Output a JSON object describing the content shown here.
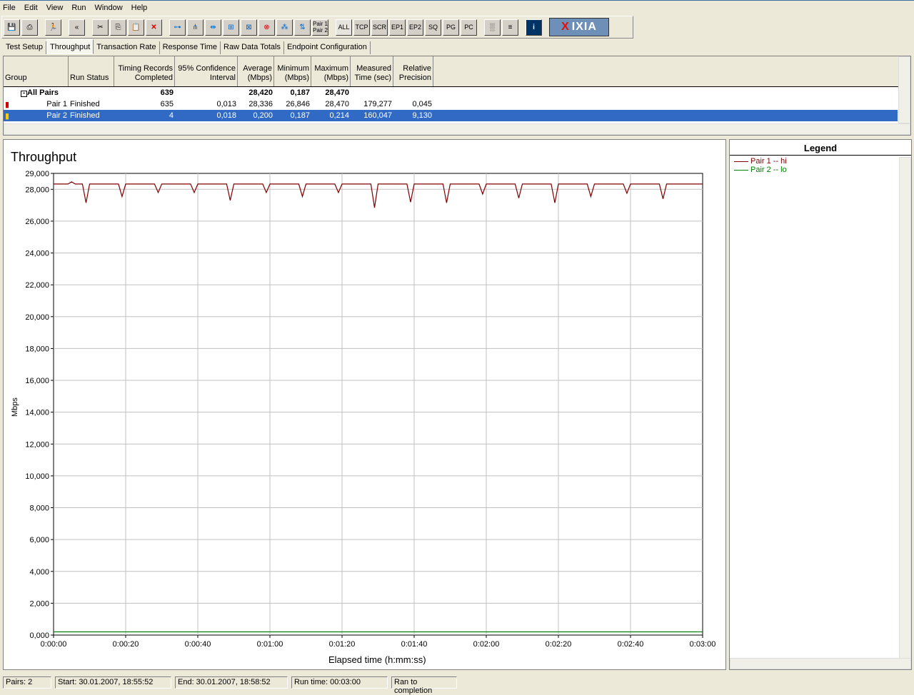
{
  "menu": [
    "File",
    "Edit",
    "View",
    "Run",
    "Window",
    "Help"
  ],
  "toolbar": {
    "text_buttons": [
      "ALL",
      "TCP",
      "SCR",
      "EP1",
      "EP2",
      "SQ",
      "PG",
      "PC"
    ],
    "pair_button": [
      "Pair 1",
      "Pair 2"
    ],
    "logo": "IXIA"
  },
  "tabs": [
    "Test Setup",
    "Throughput",
    "Transaction Rate",
    "Response Time",
    "Raw Data Totals",
    "Endpoint Configuration"
  ],
  "active_tab": "Throughput",
  "table": {
    "headers": [
      "Group",
      "Run Status",
      "Timing Records Completed",
      "95% Confidence Interval",
      "Average (Mbps)",
      "Minimum (Mbps)",
      "Maximum (Mbps)",
      "Measured Time (sec)",
      "Relative Precision"
    ],
    "summary": {
      "group": "All Pairs",
      "records": "639",
      "average": "28,420",
      "minimum": "0,187",
      "maximum": "28,470"
    },
    "rows": [
      {
        "group": "Pair 1",
        "status": "Finished",
        "records": "635",
        "ci": "0,013",
        "average": "28,336",
        "minimum": "26,846",
        "maximum": "28,470",
        "time": "179,277",
        "precision": "0,045",
        "selected": false
      },
      {
        "group": "Pair 2",
        "status": "Finished",
        "records": "4",
        "ci": "0,018",
        "average": "0,200",
        "minimum": "0,187",
        "maximum": "0,214",
        "time": "160,047",
        "precision": "9,130",
        "selected": true
      }
    ]
  },
  "legend": {
    "title": "Legend",
    "items": [
      {
        "label": "Pair 1 -- hi",
        "color": "#800000"
      },
      {
        "label": "Pair 2 -- lo",
        "color": "#008000"
      }
    ]
  },
  "chart_data": {
    "type": "line",
    "title": "Throughput",
    "xlabel": "Elapsed time (h:mm:ss)",
    "ylabel": "Mbps",
    "xlim": [
      "0:00:00",
      "0:03:00"
    ],
    "ylim": [
      0,
      29000
    ],
    "grid": true,
    "xticks": [
      "0:00:00",
      "0:00:20",
      "0:00:40",
      "0:01:00",
      "0:01:20",
      "0:01:40",
      "0:02:00",
      "0:02:20",
      "0:02:40",
      "0:03:00"
    ],
    "yticks": [
      "0,000",
      "2,000",
      "4,000",
      "6,000",
      "8,000",
      "10,000",
      "12,000",
      "14,000",
      "16,000",
      "18,000",
      "20,000",
      "22,000",
      "24,000",
      "26,000",
      "28,000",
      "29,000"
    ],
    "series": [
      {
        "name": "Pair 1 -- hi",
        "color": "#800000",
        "points": [
          [
            "0:00:00",
            28330
          ],
          [
            "0:00:04",
            28330
          ],
          [
            "0:00:05",
            28470
          ],
          [
            "0:00:06",
            28330
          ],
          [
            "0:00:08",
            28330
          ],
          [
            "0:00:09",
            27150
          ],
          [
            "0:00:10",
            28330
          ],
          [
            "0:00:18",
            28330
          ],
          [
            "0:00:19",
            27550
          ],
          [
            "0:00:20",
            28330
          ],
          [
            "0:00:28",
            28330
          ],
          [
            "0:00:29",
            27800
          ],
          [
            "0:00:30",
            28330
          ],
          [
            "0:00:38",
            28330
          ],
          [
            "0:00:39",
            27800
          ],
          [
            "0:00:40",
            28330
          ],
          [
            "0:00:48",
            28330
          ],
          [
            "0:00:49",
            27300
          ],
          [
            "0:00:50",
            28330
          ],
          [
            "0:00:58",
            28330
          ],
          [
            "0:00:59",
            27800
          ],
          [
            "0:01:00",
            28330
          ],
          [
            "0:01:08",
            28330
          ],
          [
            "0:01:09",
            27550
          ],
          [
            "0:01:10",
            28330
          ],
          [
            "0:01:18",
            28330
          ],
          [
            "0:01:19",
            27800
          ],
          [
            "0:01:20",
            28330
          ],
          [
            "0:01:28",
            28330
          ],
          [
            "0:01:29",
            26850
          ],
          [
            "0:01:30",
            28330
          ],
          [
            "0:01:38",
            28330
          ],
          [
            "0:01:39",
            27200
          ],
          [
            "0:01:40",
            28330
          ],
          [
            "0:01:48",
            28330
          ],
          [
            "0:01:49",
            27150
          ],
          [
            "0:01:50",
            28330
          ],
          [
            "0:01:58",
            28330
          ],
          [
            "0:01:59",
            27700
          ],
          [
            "0:02:00",
            28330
          ],
          [
            "0:02:08",
            28330
          ],
          [
            "0:02:09",
            27450
          ],
          [
            "0:02:10",
            28330
          ],
          [
            "0:02:18",
            28330
          ],
          [
            "0:02:19",
            27150
          ],
          [
            "0:02:20",
            28330
          ],
          [
            "0:02:28",
            28330
          ],
          [
            "0:02:29",
            27550
          ],
          [
            "0:02:30",
            28330
          ],
          [
            "0:02:38",
            28330
          ],
          [
            "0:02:39",
            27750
          ],
          [
            "0:02:40",
            28330
          ],
          [
            "0:02:48",
            28330
          ],
          [
            "0:02:49",
            27400
          ],
          [
            "0:02:50",
            28330
          ],
          [
            "0:03:00",
            28330
          ]
        ]
      },
      {
        "name": "Pair 2 -- lo",
        "color": "#008000",
        "points": [
          [
            "0:00:00",
            200
          ],
          [
            "0:03:00",
            200
          ]
        ]
      }
    ]
  },
  "status": {
    "pairs": "Pairs: 2",
    "start": "Start: 30.01.2007, 18:55:52",
    "end": "End: 30.01.2007, 18:58:52",
    "runtime": "Run time: 00:03:00",
    "result": "Ran to completion"
  }
}
